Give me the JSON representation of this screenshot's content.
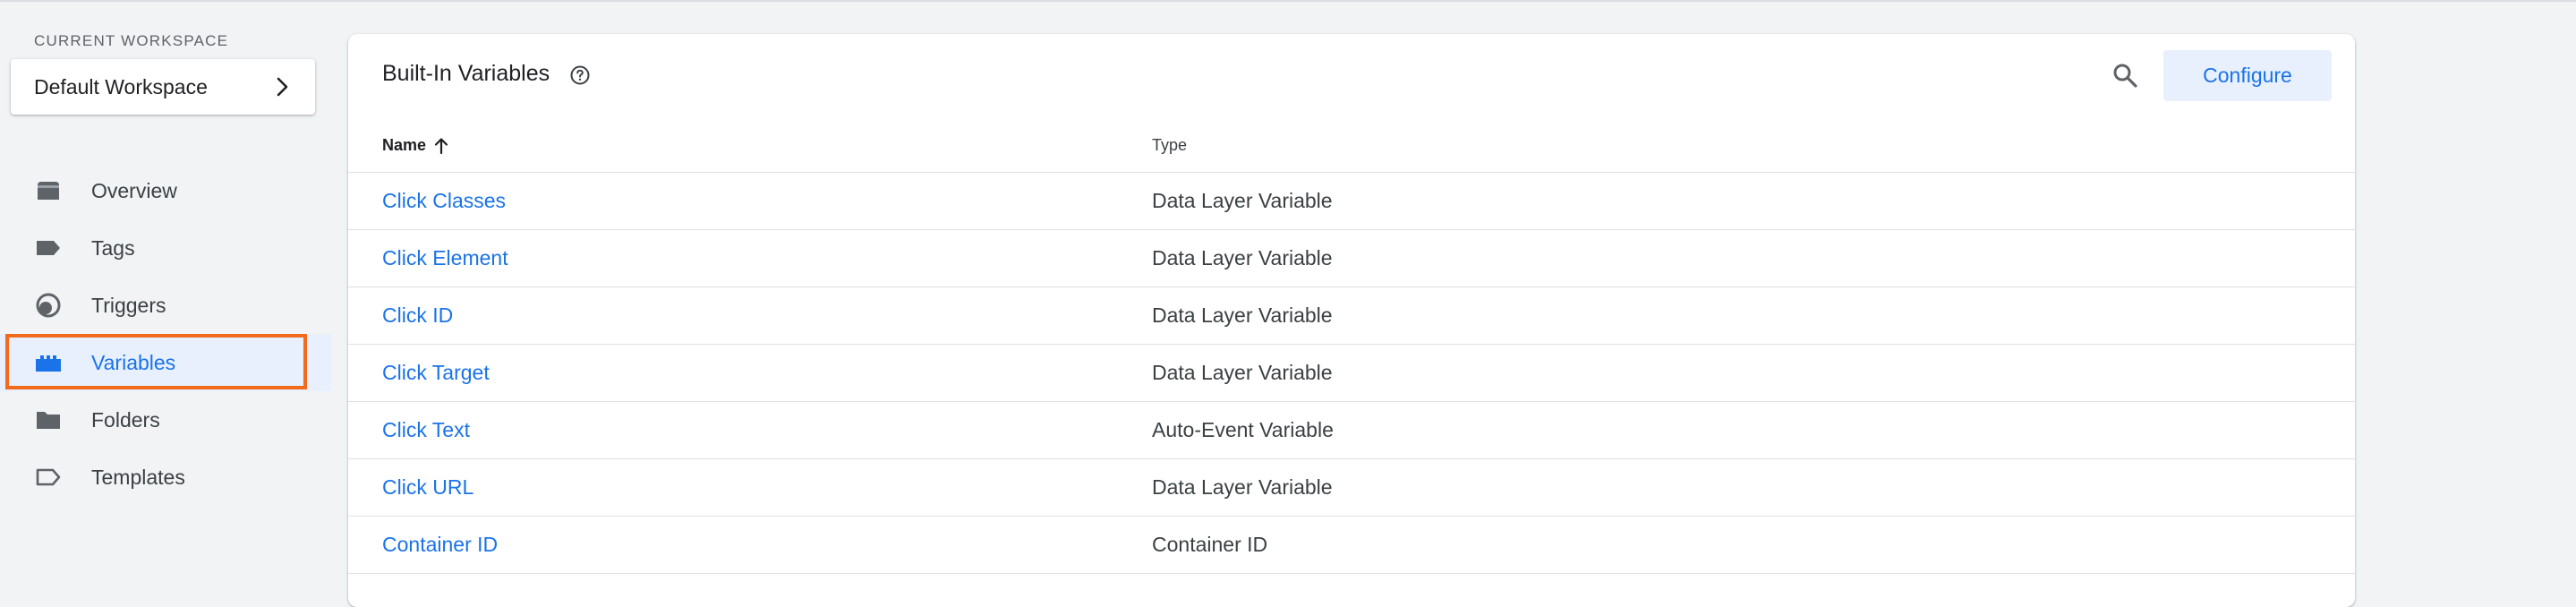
{
  "sidebar": {
    "workspace_label": "CURRENT WORKSPACE",
    "workspace_name": "Default Workspace",
    "items": [
      {
        "label": "Overview",
        "icon": "overview-icon"
      },
      {
        "label": "Tags",
        "icon": "tag-icon"
      },
      {
        "label": "Triggers",
        "icon": "trigger-icon"
      },
      {
        "label": "Variables",
        "icon": "variables-icon",
        "active": true
      },
      {
        "label": "Folders",
        "icon": "folder-icon"
      },
      {
        "label": "Templates",
        "icon": "template-icon"
      }
    ]
  },
  "main": {
    "title": "Built-In Variables",
    "configure_label": "Configure",
    "columns": {
      "name": "Name",
      "type": "Type"
    },
    "sort": "name-ascending",
    "rows": [
      {
        "name": "Click Classes",
        "type": "Data Layer Variable"
      },
      {
        "name": "Click Element",
        "type": "Data Layer Variable"
      },
      {
        "name": "Click ID",
        "type": "Data Layer Variable"
      },
      {
        "name": "Click Target",
        "type": "Data Layer Variable"
      },
      {
        "name": "Click Text",
        "type": "Auto-Event Variable"
      },
      {
        "name": "Click URL",
        "type": "Data Layer Variable"
      },
      {
        "name": "Container ID",
        "type": "Container ID"
      }
    ]
  },
  "colors": {
    "accent": "#1a73e8",
    "active_bg": "#e8f0fe",
    "highlight": "#f26a1b",
    "icon": "#5f6368"
  }
}
